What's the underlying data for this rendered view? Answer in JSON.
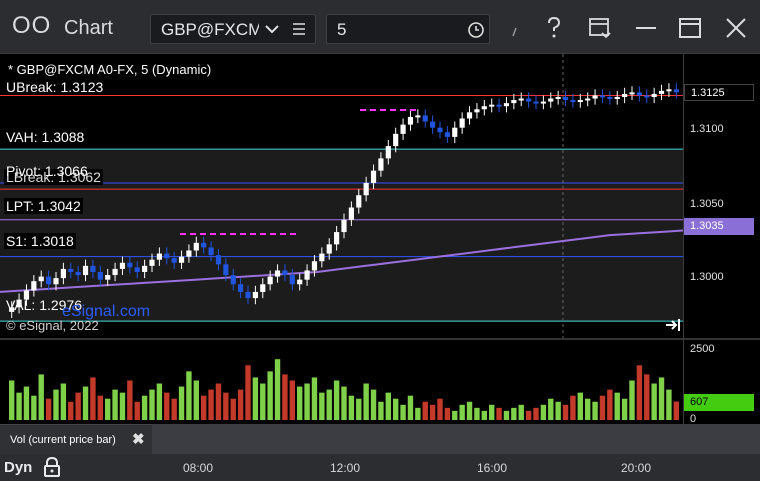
{
  "window": {
    "app_title": "Chart",
    "app_icon": "OO",
    "symbol": "GBP@FXCM",
    "interval": "5",
    "colors": {
      "bg": "#000000",
      "titlebar": "#2b2d31",
      "up_bar": "#ffffff",
      "down_bar": "#2255dd",
      "accent_magenta": "#ff33ff",
      "accent_green": "#22aa22"
    }
  },
  "chart": {
    "header": "* GBP@FXCM A0-FX, 5 (Dynamic)",
    "levels": {
      "ubreak": "UBreak: 1.3123",
      "vah": "VAH: 1.3088",
      "pivot": "Pivot: 1.3066",
      "lbreak_partial": "LBreak: 1.3062",
      "lpt": "LPT: 1.3042",
      "s1": "S1: 1.3018",
      "val": "VAL: 1.2976"
    },
    "price_ticks": [
      "1.3100",
      "1.3050",
      "1.3000"
    ],
    "price_tags": [
      {
        "label": "1.3125",
        "color": "#ffffff",
        "bg": "#000000"
      },
      {
        "label": "1.3035",
        "color": "#ffffff",
        "bg": "#8a6fd6"
      }
    ],
    "copyright": "© eSignal, 2022",
    "watermark": "eSignal.com"
  },
  "volume": {
    "legend": "Vol (current price bar)",
    "ticks": [
      "2500",
      "0"
    ],
    "current": "607",
    "current_bg": "#44cc11"
  },
  "time_axis": {
    "dyn_label": "Dyn",
    "labels": [
      "08:00",
      "12:00",
      "16:00",
      "20:00"
    ]
  },
  "chart_data": {
    "type": "candlestick",
    "title": "* GBP@FXCM A0-FX, 5 (Dynamic)",
    "y_range": [
      1.2965,
      1.315
    ],
    "x_labels": [
      "08:00",
      "12:00",
      "16:00",
      "20:00"
    ],
    "levels": [
      {
        "name": "UBreak",
        "value": 1.3123,
        "color": "#ff3333"
      },
      {
        "name": "VAH",
        "value": 1.3088,
        "color": "#44dddd"
      },
      {
        "name": "Pivot",
        "value": 1.3066,
        "color": "#3355ff"
      },
      {
        "name": "LBreak",
        "value": 1.3062,
        "color": "#ff3333"
      },
      {
        "name": "LPT",
        "value": 1.3042,
        "color": "#aa77ee"
      },
      {
        "name": "S1",
        "value": 1.3018,
        "color": "#3355ff"
      },
      {
        "name": "VAL",
        "value": 1.2976,
        "color": "#44dddd"
      }
    ],
    "closes": [
      1.2985,
      1.299,
      1.2996,
      1.3002,
      1.3005,
      1.3,
      1.3004,
      1.301,
      1.3008,
      1.3006,
      1.3012,
      1.3008,
      1.3003,
      1.3006,
      1.301,
      1.3014,
      1.3011,
      1.3008,
      1.3012,
      1.3016,
      1.302,
      1.3017,
      1.3014,
      1.3018,
      1.3022,
      1.3027,
      1.3024,
      1.3019,
      1.3013,
      1.3006,
      1.3,
      1.2995,
      1.2991,
      1.2995,
      1.3,
      1.3005,
      1.3009,
      1.3006,
      1.3,
      1.3003,
      1.3009,
      1.3015,
      1.302,
      1.3026,
      1.3034,
      1.3042,
      1.305,
      1.3058,
      1.3066,
      1.3074,
      1.3082,
      1.309,
      1.3098,
      1.3104,
      1.3109,
      1.311,
      1.3106,
      1.3102,
      1.3099,
      1.3096,
      1.3102,
      1.3108,
      1.3112,
      1.3114,
      1.3116,
      1.3117,
      1.3116,
      1.3118,
      1.312,
      1.3121,
      1.3119,
      1.3118,
      1.3119,
      1.3121,
      1.3122,
      1.312,
      1.3119,
      1.312,
      1.3121,
      1.3123,
      1.3122,
      1.3121,
      1.3122,
      1.3124,
      1.3125,
      1.3123,
      1.3122,
      1.3124,
      1.3126,
      1.3127,
      1.3125
    ],
    "volume": [
      1300,
      900,
      1100,
      800,
      1500,
      700,
      1000,
      1200,
      600,
      900,
      1100,
      1400,
      800,
      700,
      1000,
      900,
      1300,
      600,
      800,
      1000,
      1200,
      900,
      700,
      1100,
      1600,
      1300,
      800,
      1000,
      1200,
      900,
      700,
      1000,
      1800,
      1400,
      1200,
      1600,
      2000,
      1500,
      1300,
      1100,
      1200,
      1400,
      900,
      1000,
      1300,
      1100,
      800,
      700,
      1200,
      1000,
      600,
      900,
      700,
      500,
      800,
      400,
      600,
      500,
      700,
      400,
      300,
      500,
      600,
      400,
      300,
      500,
      400,
      300,
      400,
      500,
      300,
      400,
      500,
      700,
      600,
      500,
      800,
      900,
      700,
      600,
      800,
      1000,
      900,
      700,
      1300,
      1800,
      1500,
      1200,
      1400,
      1000,
      607
    ],
    "ma": [
      1.2995,
      1.2996,
      1.2997,
      1.2998,
      1.2999,
      1.3,
      1.3001,
      1.3002,
      1.3003,
      1.3004,
      1.3005,
      1.3006,
      1.3007,
      1.3008,
      1.301,
      1.3012,
      1.3014,
      1.3016,
      1.3018,
      1.302,
      1.3022,
      1.3024,
      1.3026,
      1.3028,
      1.303,
      1.3032,
      1.3033,
      1.3034,
      1.3035
    ]
  }
}
